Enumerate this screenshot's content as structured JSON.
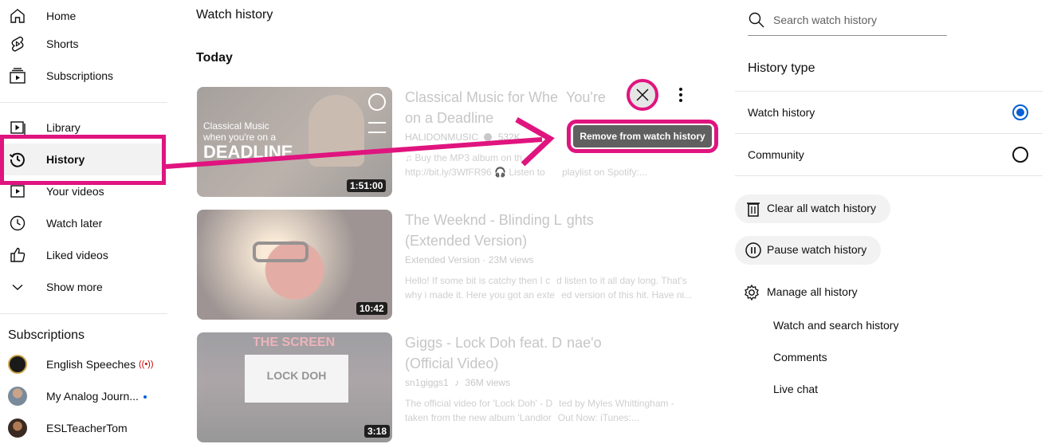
{
  "sidebar": {
    "items": [
      {
        "label": "Home",
        "icon": "home-icon"
      },
      {
        "label": "Shorts",
        "icon": "shorts-icon"
      },
      {
        "label": "Subscriptions",
        "icon": "subscriptions-icon"
      },
      {
        "label": "Library",
        "icon": "library-icon"
      },
      {
        "label": "History",
        "icon": "history-icon"
      },
      {
        "label": "Your videos",
        "icon": "your-videos-icon"
      },
      {
        "label": "Watch later",
        "icon": "watch-later-icon"
      },
      {
        "label": "Liked videos",
        "icon": "thumbs-up-icon"
      },
      {
        "label": "Show more",
        "icon": "chevron-down-icon"
      }
    ],
    "subscriptions_title": "Subscriptions",
    "subscriptions": [
      {
        "label": "English Speeches",
        "badge": "live"
      },
      {
        "label": "My Analog Journ...",
        "badge": "new"
      },
      {
        "label": "ESLTeacherTom",
        "badge": ""
      }
    ]
  },
  "main": {
    "title": "Watch history",
    "day": "Today",
    "videos": [
      {
        "title_a": "Classical Music for Whe",
        "title_b": "You're",
        "title_c": "on a Deadline",
        "channel": "HALIDONMUSIC",
        "views": "532K",
        "desc_a": "Buy the MP3 album on th",
        "desc_b": "http://bit.ly/3WfFR96",
        "desc_c": "Listen to",
        "desc_d": "playlist on Spotify:...",
        "duration": "1:51:00",
        "thumb_text_1": "Classical Music",
        "thumb_text_2": "when you're on a",
        "thumb_text_3": "DEADLINE"
      },
      {
        "title_a": "The Weeknd - Blinding L",
        "title_b": "ghts",
        "title_c": "(Extended Version)",
        "meta": "Extended Version · 23M views",
        "desc_a": "Hello! If some bit is catchy then I c",
        "desc_b": "d listen to it all day long. That's",
        "desc_c": "why i made it. Here you got an exte",
        "desc_d": "ed version of this hit. Have ni...",
        "duration": "10:42"
      },
      {
        "title_a": "Giggs - Lock Doh feat. D",
        "title_b": "nae'o",
        "title_c": "(Official Video)",
        "meta_a": "sn1giggs1",
        "meta_b": "36M views",
        "desc_a": "The official video for 'Lock Doh' - D",
        "desc_b": "ted by Myles Whittingham -",
        "desc_c": "taken from the new album 'Landlor",
        "desc_d": "Out Now: iTunes:...",
        "duration": "3:18",
        "thumb_text_1": "LOCK DOH",
        "thumb_text_2": "THE SCREEN"
      }
    ],
    "tooltip": "Remove from watch history"
  },
  "right": {
    "search_placeholder": "Search watch history",
    "history_type_title": "History type",
    "history_types": [
      {
        "label": "Watch history",
        "selected": true
      },
      {
        "label": "Community",
        "selected": false
      }
    ],
    "actions": [
      {
        "label": "Clear all watch history",
        "icon": "trash-icon"
      },
      {
        "label": "Pause watch history",
        "icon": "pause-icon"
      }
    ],
    "manage_label": "Manage all history",
    "manage_links": [
      "Watch and search history",
      "Comments",
      "Live chat"
    ]
  },
  "colors": {
    "annotation": "#e0147f",
    "radio_selected": "#065fd4",
    "tooltip_bg": "#606060"
  }
}
